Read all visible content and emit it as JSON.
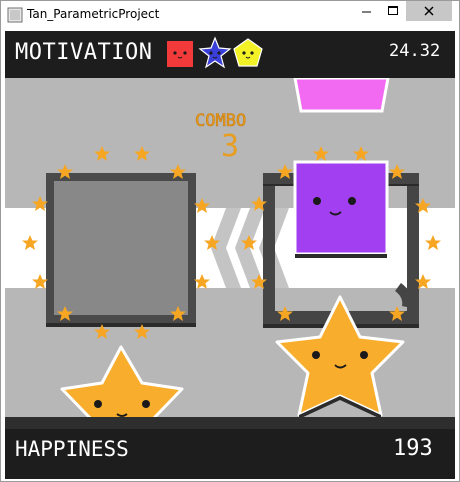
{
  "window": {
    "title": "Tan_ParametricProject",
    "controls": [
      "minimize",
      "maximize",
      "close"
    ]
  },
  "hud": {
    "motivation_label": "MOTIVATION",
    "timer": "24.32",
    "combo_label": "COMBO",
    "combo_count": "3",
    "happiness_label": "HAPPINESS",
    "score": "193"
  },
  "motivation_shapes": [
    {
      "shape": "square",
      "color": "#f23a3a"
    },
    {
      "shape": "star",
      "color": "#3b3fd9"
    },
    {
      "shape": "pentagon",
      "color": "#f2f227"
    }
  ],
  "colors": {
    "background": "#b7b7b7",
    "hud": "#1d1d1d",
    "star_ring": "#f6a623",
    "combo": "#e79d1f",
    "purple_character": "#a23ff0",
    "pink_character": "#f26af2",
    "star_character": "#f8ad2c"
  }
}
